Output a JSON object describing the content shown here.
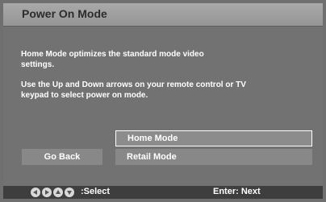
{
  "title": "Power On Mode",
  "description": [
    "Home Mode optimizes the standard mode video settings.",
    "Use the Up and Down arrows on your remote control or TV keypad to select power on mode."
  ],
  "go_back_label": "Go Back",
  "options": [
    "Home Mode",
    "Retail Mode"
  ],
  "selected_option": "Home Mode",
  "footer": {
    "nav_icons": [
      "left-arrow-icon",
      "right-arrow-icon",
      "up-arrow-icon",
      "down-arrow-icon"
    ],
    "select_hint": ":Select",
    "enter_hint": "Enter: Next"
  }
}
